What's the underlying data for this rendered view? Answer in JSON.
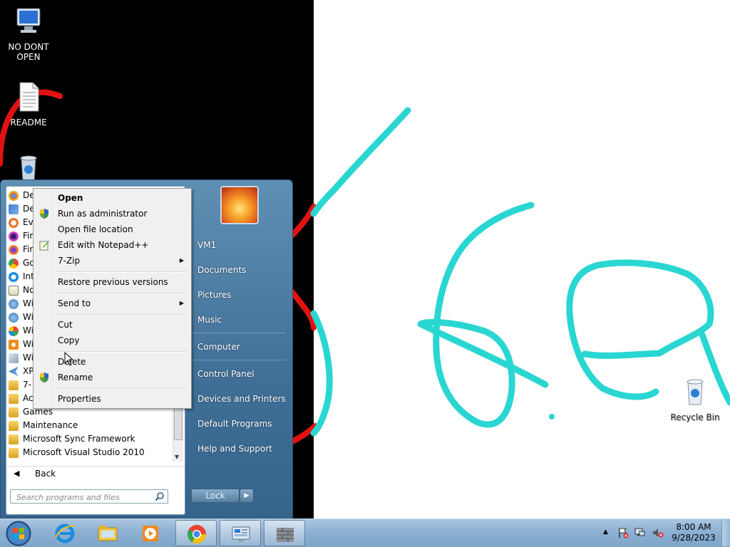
{
  "desktop": {
    "icons": [
      {
        "label_line1": "NO DONT",
        "label_line2": "OPEN",
        "icon": "computer-icon"
      },
      {
        "label": "README",
        "icon": "text-file-icon"
      },
      {
        "label": "Recycle Bin",
        "icon": "recycle-bin-icon"
      }
    ],
    "stroke_color": "#2ad6d2"
  },
  "start_menu": {
    "programs": [
      {
        "label": "De",
        "icon": "chrome-like-icon"
      },
      {
        "label": "De",
        "icon": "app-icon"
      },
      {
        "label": "Ev",
        "icon": "search-app-icon"
      },
      {
        "label": "Fir",
        "icon": "firefox-dev-icon"
      },
      {
        "label": "Fir",
        "icon": "firefox-icon"
      },
      {
        "label": "Go",
        "icon": "chrome-icon"
      },
      {
        "label": "Int",
        "icon": "ie-icon"
      },
      {
        "label": "No",
        "icon": "notepad-icon"
      },
      {
        "label": "Wi",
        "icon": "windows-icon"
      },
      {
        "label": "Wi",
        "icon": "windows-icon"
      },
      {
        "label": "Wi",
        "icon": "windows-icon"
      },
      {
        "label": "Wi",
        "icon": "media-icon"
      },
      {
        "label": "Wi",
        "icon": "windows-icon"
      },
      {
        "label": "XP",
        "icon": "vs-icon"
      },
      {
        "label": "7-",
        "icon": "folder-icon"
      },
      {
        "label": "Ac",
        "icon": "folder-icon"
      },
      {
        "label": "Games",
        "icon": "folder-icon"
      },
      {
        "label": "Maintenance",
        "icon": "folder-icon"
      },
      {
        "label": "Microsoft Sync Framework",
        "icon": "folder-icon"
      },
      {
        "label": "Microsoft Visual Studio 2010",
        "icon": "folder-icon"
      }
    ],
    "back_label": "Back",
    "search_placeholder": "Search programs and files",
    "right_items": [
      "VM1",
      "Documents",
      "Pictures",
      "Music",
      "Computer",
      "Control Panel",
      "Devices and Printers",
      "Default Programs",
      "Help and Support"
    ],
    "lock_label": "Lock"
  },
  "context_menu": {
    "items": [
      {
        "label": "Open",
        "icon": ""
      },
      {
        "label": "Run as administrator",
        "icon": "uac-shield-icon"
      },
      {
        "label": "Open file location",
        "icon": ""
      },
      {
        "label": "Edit with Notepad++",
        "icon": "notepad-plus-icon"
      },
      {
        "label": "7-Zip",
        "icon": "",
        "submenu": true
      },
      {
        "label": "Restore previous versions",
        "icon": ""
      },
      {
        "label": "Send to",
        "icon": "",
        "submenu": true
      },
      {
        "label": "Cut",
        "icon": ""
      },
      {
        "label": "Copy",
        "icon": ""
      },
      {
        "label": "Delete",
        "icon": ""
      },
      {
        "label": "Rename",
        "icon": "uac-shield-icon"
      },
      {
        "label": "Properties",
        "icon": ""
      }
    ]
  },
  "taskbar": {
    "pinned": [
      "ie-icon",
      "explorer-icon",
      "media-player-icon",
      "chrome-icon",
      "control-panel-icon",
      "firewall-icon"
    ],
    "clock_time": "8:00 AM",
    "clock_date": "9/28/2023"
  }
}
